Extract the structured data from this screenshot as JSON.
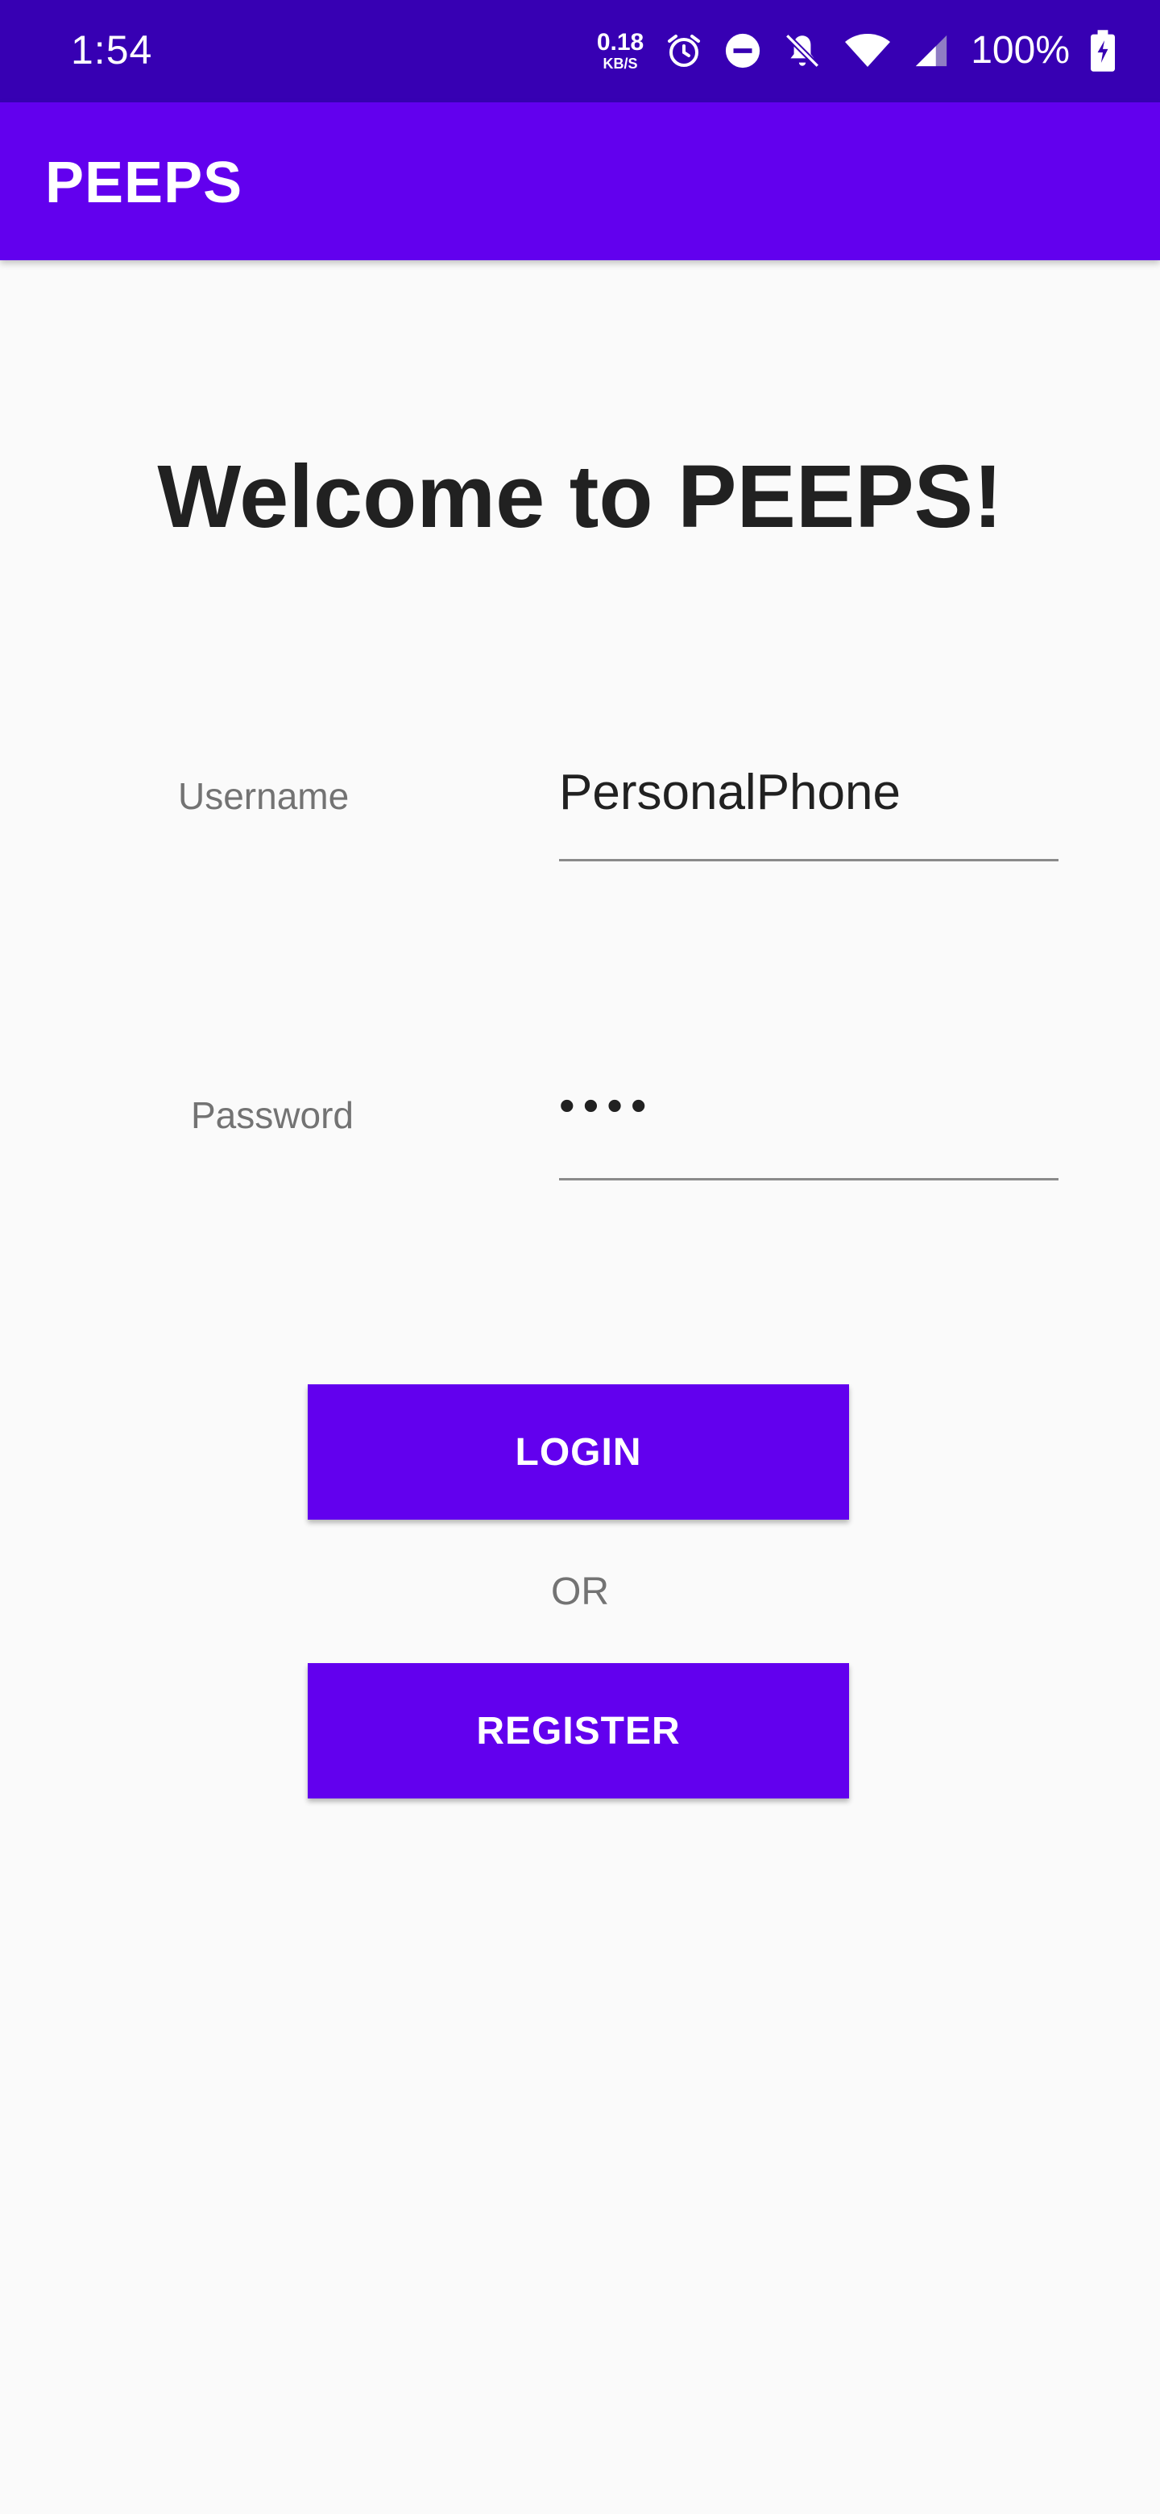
{
  "status_bar": {
    "time": "1:54",
    "net_speed_value": "0.18",
    "net_speed_unit": "KB/S",
    "battery_percent": "100%",
    "icons": [
      "alarm-icon",
      "do-not-disturb-icon",
      "bell-off-icon",
      "wifi-icon",
      "cell-signal-icon",
      "battery-charging-icon"
    ]
  },
  "app_bar": {
    "title": "PEEPS"
  },
  "main": {
    "welcome": "Welcome to PEEPS!",
    "username": {
      "label": "Username",
      "value": "PersonalPhone"
    },
    "password": {
      "label": "Password",
      "value": "••••"
    },
    "login_label": "LOGIN",
    "or_label": "OR",
    "register_label": "REGISTER"
  },
  "colors": {
    "status_bar": "#3700b3",
    "primary": "#6200ee",
    "background": "#fafafa"
  }
}
